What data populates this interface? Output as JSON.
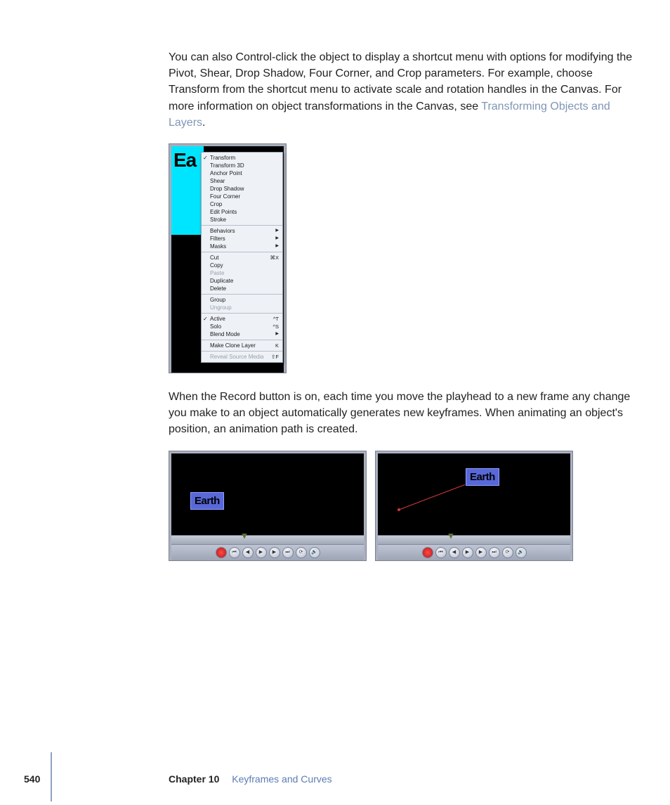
{
  "paragraph1_a": "You can also Control-click the object to display a shortcut menu with options for modifying the Pivot, Shear, Drop Shadow, Four Corner, and Crop parameters. For example, choose Transform from the shortcut menu to activate scale and rotation handles in the Canvas. For more information on object transformations in the Canvas, see ",
  "paragraph1_link": "Transforming Objects and Layers",
  "paragraph1_b": ".",
  "paragraph2": "When the Record button is on, each time you move the playhead to a new frame any change you make to an object automatically generates new keyframes. When animating an object's position, an animation path is created.",
  "selection_text_partial": "Ea",
  "earth_label": "Earth",
  "context_menu": {
    "group1": [
      {
        "label": "Transform",
        "checked": true
      },
      {
        "label": "Transform 3D"
      },
      {
        "label": "Anchor Point"
      },
      {
        "label": "Shear"
      },
      {
        "label": "Drop Shadow"
      },
      {
        "label": "Four Corner"
      },
      {
        "label": "Crop"
      },
      {
        "label": "Edit Points"
      },
      {
        "label": "Stroke"
      }
    ],
    "group2": [
      {
        "label": "Behaviors",
        "submenu": true
      },
      {
        "label": "Filters",
        "submenu": true
      },
      {
        "label": "Masks",
        "submenu": true
      }
    ],
    "group3": [
      {
        "label": "Cut",
        "shortcut": "⌘X"
      },
      {
        "label": "Copy"
      },
      {
        "label": "Paste",
        "disabled": true
      },
      {
        "label": "Duplicate"
      },
      {
        "label": "Delete"
      }
    ],
    "group4": [
      {
        "label": "Group"
      },
      {
        "label": "Ungroup",
        "disabled": true
      }
    ],
    "group5": [
      {
        "label": "Active",
        "checked": true,
        "shortcut": "^T"
      },
      {
        "label": "Solo",
        "shortcut": "^S"
      },
      {
        "label": "Blend Mode",
        "submenu": true
      }
    ],
    "group6": [
      {
        "label": "Make Clone Layer",
        "shortcut": "K"
      }
    ],
    "group7": [
      {
        "label": "Reveal Source Media",
        "shortcut": "⇧F",
        "disabled": true
      }
    ]
  },
  "footer": {
    "page_number": "540",
    "chapter_label": "Chapter 10",
    "chapter_title": "Keyframes and Curves"
  }
}
